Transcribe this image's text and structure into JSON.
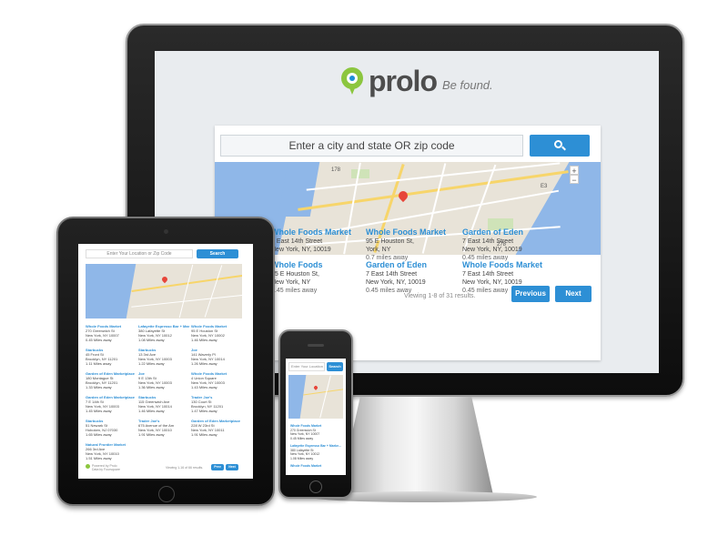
{
  "brand": {
    "name": "prolo",
    "tagline": "Be found.",
    "accent": "#2d8fd5",
    "logo_green": "#8cc63f"
  },
  "desktop": {
    "search_placeholder": "Enter a city and state OR zip code",
    "map_labels": [
      "178",
      "E3",
      "278"
    ],
    "results": [
      {
        "name": "Whole Foods Market",
        "street": "7 East 14th Street",
        "city": "New York, NY, 10019",
        "dist": ""
      },
      {
        "name": "Whole Foods Market",
        "street": "95 E Houston St,",
        "city": "York, NY",
        "dist": "0.7 miles away"
      },
      {
        "name": "Garden of Eden",
        "street": "7 East 14th Street",
        "city": "New York, NY, 10019",
        "dist": "0.45 miles away"
      },
      {
        "name": "Whole Foods",
        "street": "95 E Houston St,",
        "city": "New York, NY",
        "dist": "0.45 miles away"
      },
      {
        "name": "Garden of Eden",
        "street": "7 East 14th Street",
        "city": "New York, NY, 10019",
        "dist": "0.45 miles away"
      },
      {
        "name": "Whole Foods Market",
        "street": "7 East 14th Street",
        "city": "New York, NY, 10019",
        "dist": "0.45 miles away"
      }
    ],
    "partial_left": [
      "n",
      "arket"
    ],
    "pager": {
      "text": "Viewing 1-8 of 31 results.",
      "previous": "Previous",
      "next": "Next"
    }
  },
  "tablet": {
    "search_placeholder": "Enter Your Location or Zip Code",
    "search_button": "Search",
    "results": [
      {
        "name": "Whole Foods Market",
        "l1": "270 Greenwich St",
        "l2": "New York, NY 10007",
        "l3": "0.45 Miles away"
      },
      {
        "name": "Lafayette Espresso Bar + Mar...",
        "l1": "380 Lafayette St",
        "l2": "New York, NY 10012",
        "l3": "1.08 Miles away"
      },
      {
        "name": "Whole Foods Market",
        "l1": "95 E Houston St",
        "l2": "New York, NY 10002",
        "l3": "1.46 Miles away"
      },
      {
        "name": "Starbucks",
        "l1": "45 Front St",
        "l2": "Brooklyn, NY 11201",
        "l3": "1.11 Miles away"
      },
      {
        "name": "Starbucks",
        "l1": "13 3rd Ave",
        "l2": "New York, NY 10003",
        "l3": "1.22 Miles away"
      },
      {
        "name": "Joe",
        "l1": "141 Waverly Pl",
        "l2": "New York, NY 10014",
        "l3": "1.26 Miles away"
      },
      {
        "name": "Garden of Eden Marketplace",
        "l1": "180 Montague St",
        "l2": "Brooklyn, NY 11201",
        "l3": "1.33 Miles away"
      },
      {
        "name": "Joe",
        "l1": "9 E 13th St",
        "l2": "New York, NY 10003",
        "l3": "1.36 Miles away"
      },
      {
        "name": "Whole Foods Market",
        "l1": "4 Union Square",
        "l2": "New York, NY 10003",
        "l3": "1.43 Miles away"
      },
      {
        "name": "Garden of Eden Marketplace",
        "l1": "7 E 14th St",
        "l2": "New York, NY 10003",
        "l3": "1.45 Miles away"
      },
      {
        "name": "Starbucks",
        "l1": "115 Greenwich Ave",
        "l2": "New York, NY 10014",
        "l3": "1.46 Miles away"
      },
      {
        "name": "Trader Joe's",
        "l1": "130 Court St",
        "l2": "Brooklyn, NY 11201",
        "l3": "1.47 Miles away"
      },
      {
        "name": "Starbucks",
        "l1": "51 Newark St",
        "l2": "Hoboken, NJ 07030",
        "l3": "1.65 Miles away"
      },
      {
        "name": "Trader Joe's",
        "l1": "675 Avenue of the Am",
        "l2": "New York, NY 10010",
        "l3": "1.91 Miles away"
      },
      {
        "name": "Garden of Eden Marketplace",
        "l1": "228 W 23rd St",
        "l2": "New York, NY 10011",
        "l3": "1.91 Miles away"
      },
      {
        "name": "Natural Frontier Market",
        "l1": "266 3rd Ave",
        "l2": "New York, NY 10010",
        "l3": "1.51 Miles away"
      }
    ],
    "footer_brand": "Powered by Prolo",
    "footer_sub": "Data by Foursquare",
    "pager": {
      "text": "Viewing 1-16 of 66 results.",
      "previous": "Prev",
      "next": "Next"
    }
  },
  "phone": {
    "search_placeholder": "Enter Your Location or Zip",
    "search_button": "Search",
    "results": [
      {
        "name": "Whole Foods Market",
        "l1": "270 Greenwich St",
        "l2": "New York, NY 10007",
        "l3": "0.45 Miles away"
      },
      {
        "name": "Lafayette Espresso Bar + Marke...",
        "l1": "380 Lafayette St",
        "l2": "New York, NY 10012",
        "l3": "1.08 Miles away"
      },
      {
        "name": "Whole Foods Market",
        "l1": "",
        "l2": "",
        "l3": ""
      }
    ]
  }
}
